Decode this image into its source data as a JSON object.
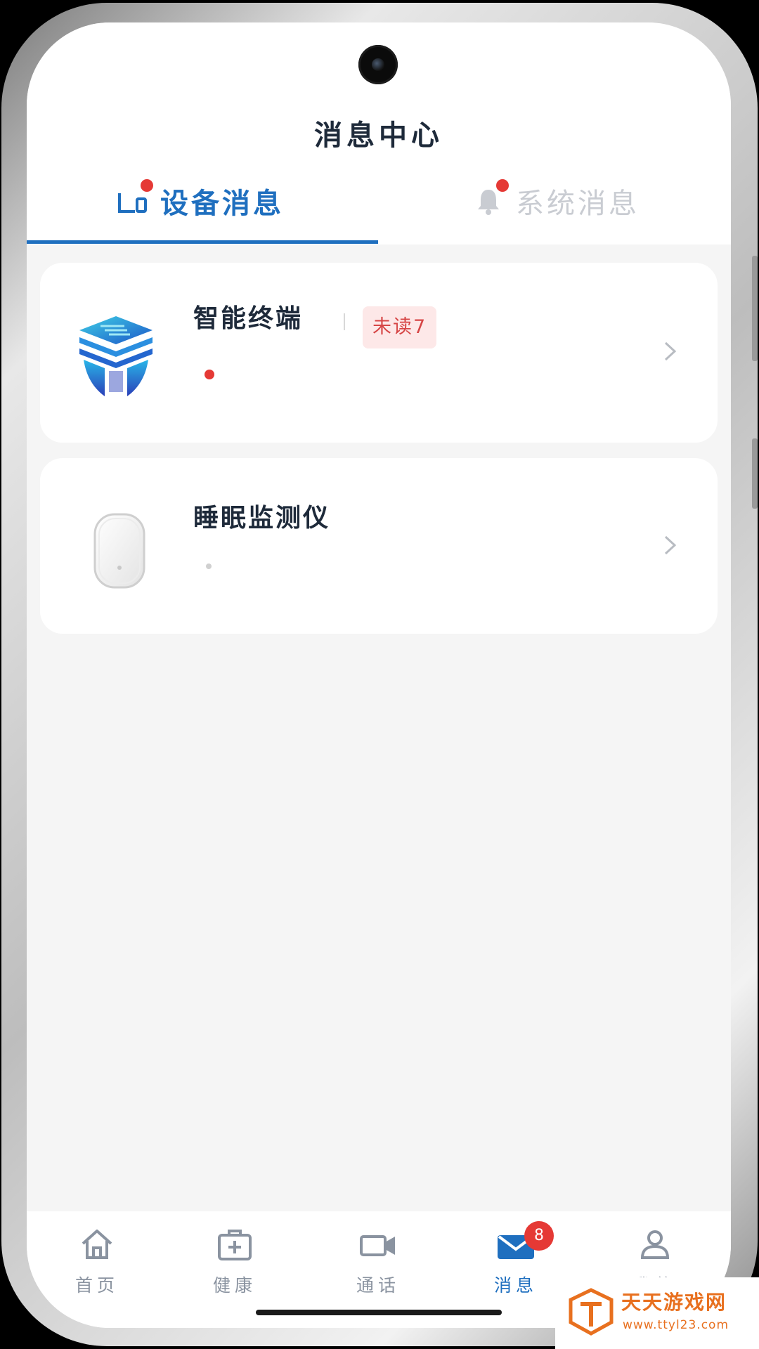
{
  "header": {
    "title": "消息中心"
  },
  "tabs": [
    {
      "label": "设备消息",
      "icon": "device-icon",
      "active": true,
      "has_dot": true
    },
    {
      "label": "系统消息",
      "icon": "bell-icon",
      "active": false,
      "has_dot": true
    }
  ],
  "devices": [
    {
      "name": "智能终端",
      "unread": "未读7",
      "icon": "smart-terminal-logo",
      "preview_dot": "red"
    },
    {
      "name": "睡眠监测仪",
      "icon": "sleep-monitor-device",
      "preview_dot": "gray"
    }
  ],
  "bottom_nav": [
    {
      "label": "首页",
      "icon": "home-icon"
    },
    {
      "label": "健康",
      "icon": "health-kit-icon"
    },
    {
      "label": "通话",
      "icon": "video-call-icon"
    },
    {
      "label": "消息",
      "icon": "mail-icon",
      "active": true,
      "badge": "8"
    },
    {
      "label": "我的",
      "icon": "user-icon"
    }
  ],
  "watermark": {
    "text": "天天游戏网",
    "url": "www.ttyl23.com"
  },
  "colors": {
    "accent": "#1f6fbf",
    "badge": "#e53935",
    "unread_bg": "#fde8e8",
    "unread_text": "#d64545"
  }
}
